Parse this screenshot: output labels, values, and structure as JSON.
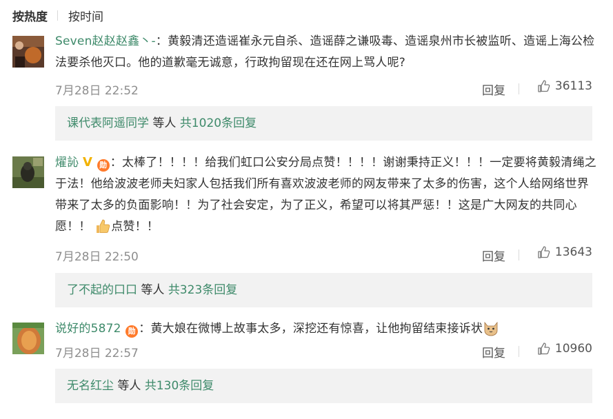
{
  "sort": {
    "active": "按热度",
    "inactive": "按时间"
  },
  "comments": [
    {
      "user": "Seven赵赵赵鑫丶-",
      "text": "：黄毅清还造谣崔永元自杀、造谣薛之谦吸毒、造谣泉州市长被监听、造谣上海公检法要杀他灭口。他的道歉毫无诚意，行政拘留现在还在网上骂人呢?",
      "time": "7月28日 22:52",
      "reply_label": "回复",
      "likes": "36113",
      "replies": {
        "who": "课代表阿遥同学",
        "etc": " 等人 ",
        "count": "共1020条回复"
      }
    },
    {
      "user": "燿訫",
      "vip_badge": "V",
      "medal": "勋",
      "text": "：太棒了！！！！给我们虹口公安分局点赞！！！！谢谢秉持正义！！！一定要将黄毅清绳之于法！他给波波老师夫妇家人包括我们所有喜欢波波老师的网友带来了太多的伤害，这个人给网络世界带来了太多的负面影响！！为了社会安定，为了正义，希望可以将其严惩！！这是广大网友的共同心愿！！",
      "emoji": "thumbs-up-emoji",
      "text_after": "点赞！！",
      "time": "7月28日 22:50",
      "reply_label": "回复",
      "likes": "13643",
      "replies": {
        "who": "了不起的口口",
        "etc": " 等人 ",
        "count": "共323条回复"
      }
    },
    {
      "user": "说好的5872",
      "medal": "勋",
      "text": "：黄大娘在微博上故事太多，深挖还有惊喜，让他拘留结束接诉状",
      "emoji": "cat-emoji",
      "time": "7月28日 22:57",
      "reply_label": "回复",
      "likes": "10960",
      "replies": {
        "who": "无名红尘",
        "etc": " 等人 ",
        "count": "共130条回复"
      }
    }
  ],
  "colors": {
    "link": "#3e8a6a",
    "meta": "#8e8e8e",
    "reply_bg": "#f2f2f2"
  }
}
